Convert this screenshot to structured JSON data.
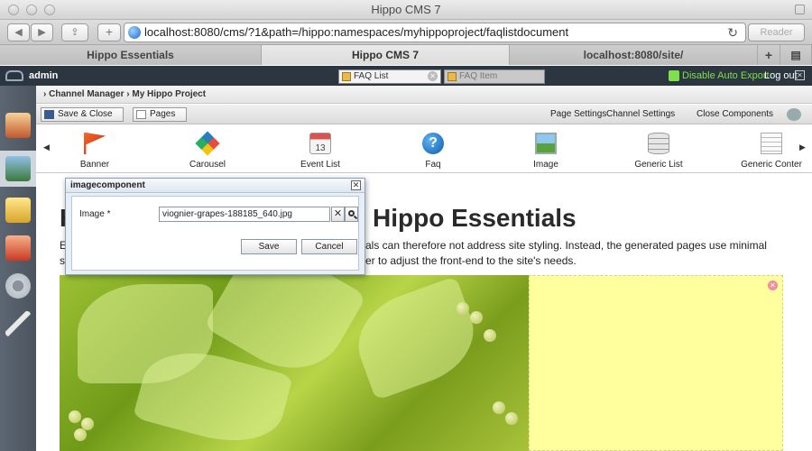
{
  "window": {
    "title": "Hippo CMS 7"
  },
  "toolbar": {
    "url": "localhost:8080/cms/?1&path=/hippo:namespaces/myhippoproject/faqlistdocument",
    "reader_label": "Reader"
  },
  "tabs": [
    {
      "label": "Hippo Essentials"
    },
    {
      "label": "Hippo CMS 7"
    },
    {
      "label": "localhost:8080/site/"
    }
  ],
  "cms": {
    "user": "admin",
    "doc_tabs": [
      {
        "label": "FAQ List"
      },
      {
        "label": "FAQ Item"
      }
    ],
    "export_label": "Disable Auto Export",
    "logout_label": "Log out"
  },
  "breadcrumb": {
    "root": "Channel Manager",
    "separator": "›",
    "current": "My Hippo Project"
  },
  "actions": {
    "save_close": "Save & Close",
    "pages": "Pages",
    "page_settings": "Page Settings",
    "channel_settings": "Channel Settings",
    "close_components": "Close Components"
  },
  "palette": [
    {
      "label": "Banner",
      "icon": "flag-icon",
      "color": "#e0451b"
    },
    {
      "label": "Carousel",
      "icon": "carousel-icon",
      "color": "#e87a1c"
    },
    {
      "label": "Event List",
      "icon": "calendar-icon",
      "color": "#c0392b"
    },
    {
      "label": "Faq",
      "icon": "help-icon",
      "color": "#1a73c9"
    },
    {
      "label": "Image",
      "icon": "image-icon",
      "color": "#4a9a3a"
    },
    {
      "label": "Generic List",
      "icon": "database-icon",
      "color": "#aaaaaa"
    },
    {
      "label": "Generic Conter",
      "icon": "document-icon",
      "color": "#bbbbbb"
    }
  ],
  "page": {
    "heading_start": "H",
    "heading_end": "Hippo Essentials",
    "para_line1_start": "E",
    "para_line1_end": "als can therefore not address site styling. Instead, the generated pages use minimal",
    "para_line2_start": "s",
    "para_line2_end": "er to adjust the front-end to the site's needs."
  },
  "dialog": {
    "title": "imagecomponent",
    "image_label": "Image *",
    "image_value": "viognier-grapes-188185_640.jpg",
    "save_label": "Save",
    "cancel_label": "Cancel"
  }
}
